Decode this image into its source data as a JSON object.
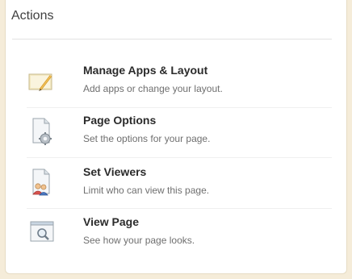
{
  "panel": {
    "title": "Actions"
  },
  "actions": [
    {
      "label": "Manage Apps & Layout",
      "description": "Add apps or change your layout.",
      "icon": "edit-layout-icon"
    },
    {
      "label": "Page Options",
      "description": "Set the options for your page.",
      "icon": "page-gear-icon"
    },
    {
      "label": "Set Viewers",
      "description": "Limit who can view this page.",
      "icon": "page-people-icon"
    },
    {
      "label": "View Page",
      "description": "See how your page looks.",
      "icon": "page-magnifier-icon"
    }
  ]
}
